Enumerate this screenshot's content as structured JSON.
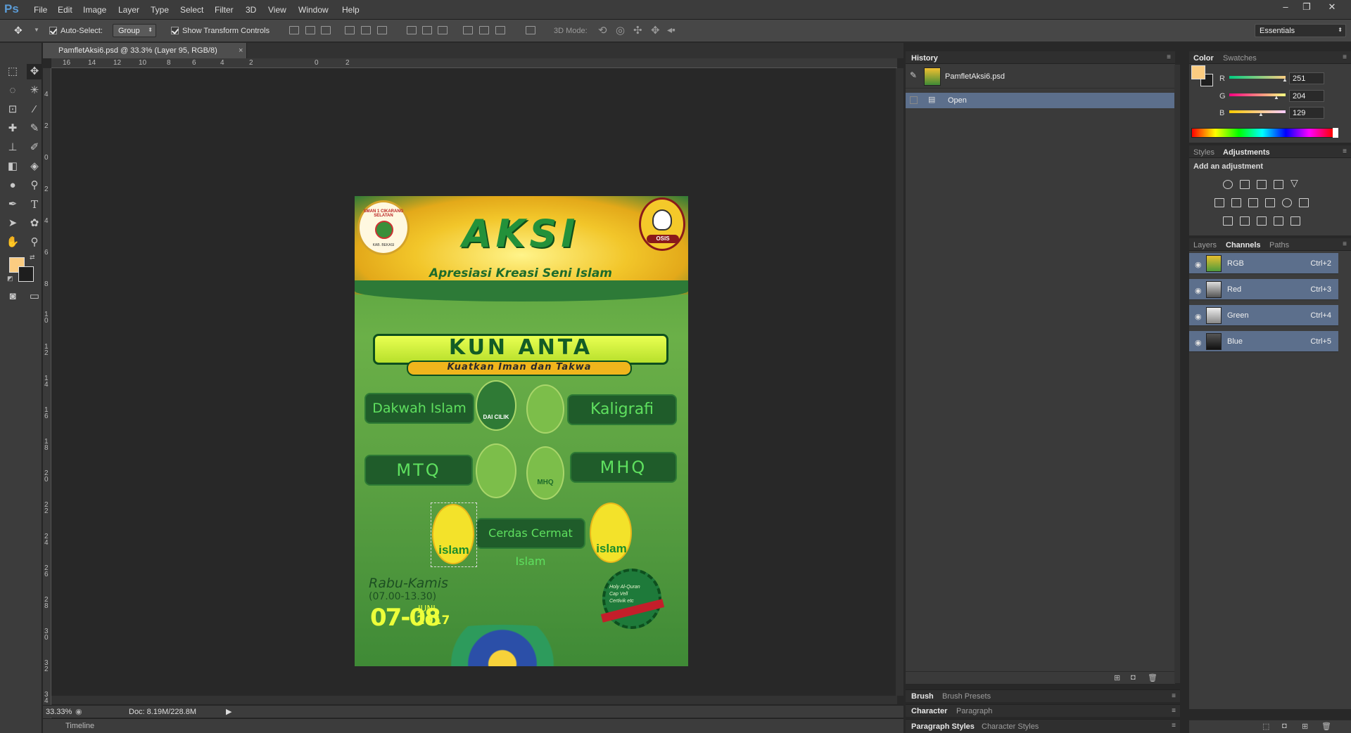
{
  "app": {
    "logo": "Ps"
  },
  "menu": [
    "File",
    "Edit",
    "Image",
    "Layer",
    "Type",
    "Select",
    "Filter",
    "3D",
    "View",
    "Window",
    "Help"
  ],
  "window_controls": {
    "minimize": "–",
    "restore": "❐",
    "close": "✕"
  },
  "options": {
    "auto_select_label": "Auto-Select:",
    "auto_select_value": "Group",
    "show_transform_label": "Show Transform Controls",
    "mode_3d_label": "3D Mode:",
    "workspace": "Essentials"
  },
  "document": {
    "tab_title": "PamfletAksi6.psd @ 33.3% (Layer 95, RGB/8)",
    "tab_close": "×",
    "ruler_h": [
      "16",
      "14",
      "12",
      "10",
      "8",
      "6",
      "4",
      "2",
      "0",
      "2"
    ],
    "ruler_v": [
      "4",
      "2",
      "0",
      "2",
      "4",
      "6",
      "8",
      "1 0",
      "1 2",
      "1 4",
      "1 6",
      "1 8",
      "2 0",
      "2 2",
      "2 4",
      "2 6",
      "2 8",
      "3 0",
      "3 2",
      "3 4"
    ],
    "zoom": "33.33%",
    "doc_size": "Doc: 8.19M/228.8M"
  },
  "poster": {
    "title": "AKSI",
    "subtitle": "Apresiasi Kreasi Seni Islam",
    "banner": "KUN ANTA",
    "banner_sub": "Kuatkan Iman dan Takwa",
    "dakwah": "Dakwah Islam",
    "kaligrafi": "Kaligrafi",
    "mtq": "MTQ",
    "mhq": "MHQ",
    "mhq_small": "MHQ",
    "cerdas": "Cerdas Cermat Islam",
    "islam": "islam",
    "dai_cilik": "DAI CILIK",
    "osis": "OSIS",
    "school_badge": "SMAN 1 CIKARANG SELATAN",
    "school_badge_sub": "KAB. BEKASI",
    "day": "Rabu-Kamis",
    "time": "(07.00-13.30)",
    "date": "07-08",
    "month": "JUNI",
    "year": "2017",
    "seal_lines": [
      "Holy Al-Quran",
      "Cap",
      "Vell",
      "Certivik",
      "etc"
    ]
  },
  "timeline_label": "Timeline",
  "history": {
    "tab": "History",
    "snapshot": "PamfletAksi6.psd",
    "steps": [
      "Open"
    ]
  },
  "color_panel": {
    "tabs": [
      "Color",
      "Swatches"
    ],
    "r_label": "R",
    "g_label": "G",
    "b_label": "B",
    "r": "251",
    "g": "204",
    "b": "129",
    "foreground": "#fbcc81",
    "background": "#1e1e1e"
  },
  "adjustments": {
    "tabs": [
      "Styles",
      "Adjustments"
    ],
    "heading": "Add an adjustment"
  },
  "channels": {
    "tabs": [
      "Layers",
      "Channels",
      "Paths"
    ],
    "rows": [
      {
        "name": "RGB",
        "key": "Ctrl+2"
      },
      {
        "name": "Red",
        "key": "Ctrl+3"
      },
      {
        "name": "Green",
        "key": "Ctrl+4"
      },
      {
        "name": "Blue",
        "key": "Ctrl+5"
      }
    ]
  },
  "bottom_panels": {
    "brush_tabs": [
      "Brush",
      "Brush Presets"
    ],
    "char_tabs": [
      "Character",
      "Paragraph"
    ],
    "style_tabs": [
      "Paragraph Styles",
      "Character Styles"
    ]
  }
}
